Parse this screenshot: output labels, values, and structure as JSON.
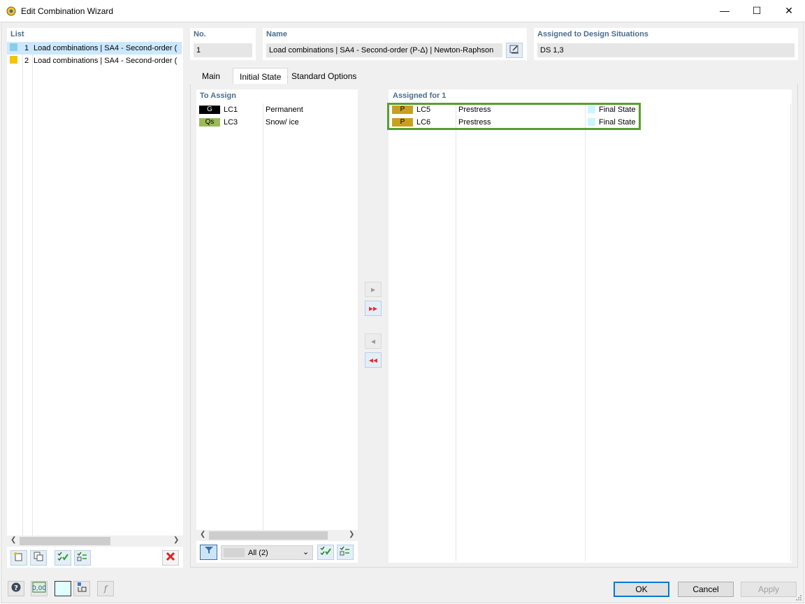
{
  "window": {
    "title": "Edit Combination Wizard"
  },
  "list": {
    "header": "List",
    "items": [
      {
        "no": "1",
        "label": "Load combinations | SA4 - Second-order (",
        "color": "#87ceeb",
        "selected": true
      },
      {
        "no": "2",
        "label": "Load combinations | SA4 - Second-order (",
        "color": "#f5c400",
        "selected": false
      }
    ]
  },
  "no": {
    "label": "No.",
    "value": "1"
  },
  "name": {
    "label": "Name",
    "value": "Load combinations | SA4 - Second-order (P-Δ) | Newton-Raphson"
  },
  "design_situations": {
    "label": "Assigned to Design Situations",
    "value": "DS 1,3"
  },
  "tabs": [
    {
      "label": "Main",
      "active": false
    },
    {
      "label": "Initial State",
      "active": true
    },
    {
      "label": "Standard Options",
      "active": false
    }
  ],
  "to_assign": {
    "header": "To Assign",
    "rows": [
      {
        "badge": "G",
        "badge_bg": "#000000",
        "badge_fg": "#ffffff",
        "lc": "LC1",
        "desc": "Permanent"
      },
      {
        "badge": "Qs",
        "badge_bg": "#9bba59",
        "badge_fg": "#000000",
        "lc": "LC3",
        "desc": "Snow/ ice"
      }
    ],
    "filter_value": "All (2)"
  },
  "assigned": {
    "header": "Assigned for 1",
    "rows": [
      {
        "badge": "P",
        "badge_bg": "#c8a020",
        "lc": "LC5",
        "desc": "Prestress",
        "state": "Final State"
      },
      {
        "badge": "P",
        "badge_bg": "#c8a020",
        "lc": "LC6",
        "desc": "Prestress",
        "state": "Final State"
      }
    ]
  },
  "buttons": {
    "ok": "OK",
    "cancel": "Cancel",
    "apply": "Apply"
  },
  "accent": {
    "highlight_border": "#5a9e2f",
    "selection": "#cce8ff",
    "header_text": "#4a6d8c"
  }
}
